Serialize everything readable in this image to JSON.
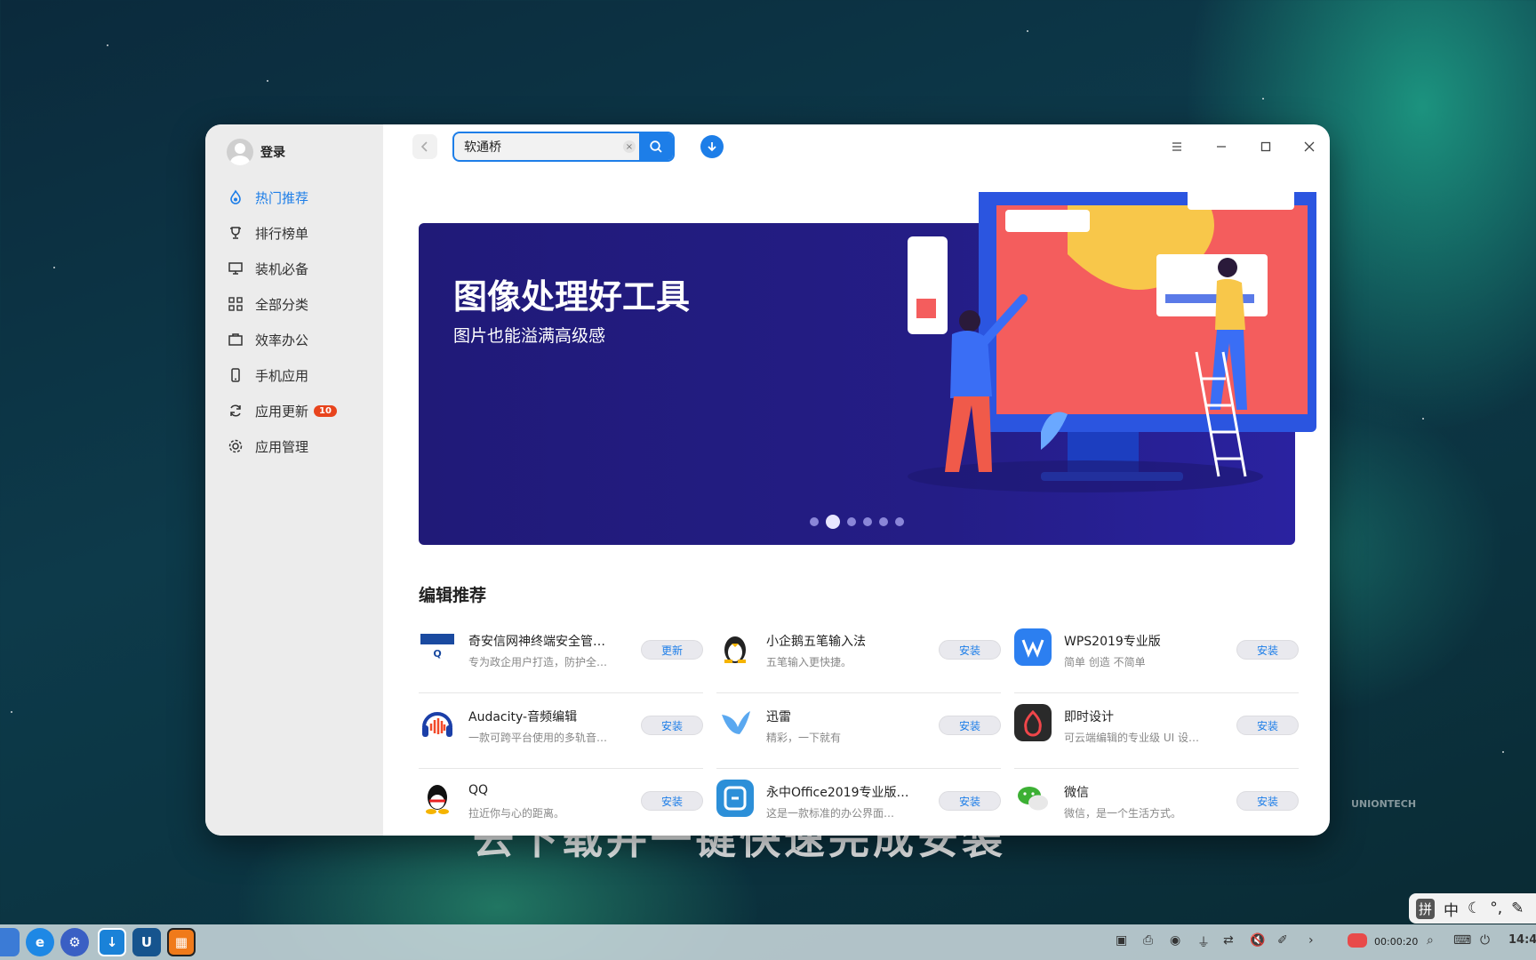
{
  "sidebar": {
    "user_label": "登录",
    "items": [
      {
        "label": "热门推荐",
        "icon": "hot-icon"
      },
      {
        "label": "排行榜单",
        "icon": "trophy-icon"
      },
      {
        "label": "装机必备",
        "icon": "monitor-icon"
      },
      {
        "label": "全部分类",
        "icon": "grid-icon"
      },
      {
        "label": "效率办公",
        "icon": "briefcase-icon"
      },
      {
        "label": "手机应用",
        "icon": "phone-icon"
      },
      {
        "label": "应用更新",
        "icon": "refresh-icon",
        "badge": "10"
      },
      {
        "label": "应用管理",
        "icon": "gear-icon"
      }
    ]
  },
  "search": {
    "value": "软通桥"
  },
  "banner": {
    "title": "图像处理好工具",
    "subtitle": "图片也能溢满高级感",
    "active_dot": 2,
    "dot_count": 6
  },
  "recommend": {
    "title": "编辑推荐",
    "apps": [
      {
        "name": "奇安信网神终端安全管…",
        "desc": "专为政企用户打造，防护全…",
        "button": "更新",
        "icon_color": "#1a4aa0"
      },
      {
        "name": "小企鹅五笔输入法",
        "desc": "五笔输入更快捷。",
        "button": "安装",
        "icon_color": "#ffffff"
      },
      {
        "name": "WPS2019专业版",
        "desc": "简单 创造 不简单",
        "button": "安装",
        "icon_color": "#2c7ff0"
      },
      {
        "name": "Audacity-音频编辑",
        "desc": "一款可跨平台使用的多轨音…",
        "button": "安装",
        "icon_color": "#1b3fa8"
      },
      {
        "name": "迅雷",
        "desc": "精彩，一下就有",
        "button": "安装",
        "icon_color": "#5aa8f0"
      },
      {
        "name": "即时设计",
        "desc": "可云端编辑的专业级 UI 设…",
        "button": "安装",
        "icon_color": "#2a2a2a"
      },
      {
        "name": "QQ",
        "desc": "拉近你与心的距离。",
        "button": "安装",
        "icon_color": "#ffffff"
      },
      {
        "name": "永中Office2019专业版…",
        "desc": "这是一款标准的办公界面…",
        "button": "安装",
        "icon_color": "#2c8fd8"
      },
      {
        "name": "微信",
        "desc": "微信，是一个生活方式。",
        "button": "安装",
        "icon_color": "#ffffff"
      }
    ]
  },
  "overlay": {
    "caption": "去下载并一键快速完成安装",
    "watermark": "UNIONTECH"
  },
  "ime": {
    "pinyin": "拼",
    "zh": "中"
  },
  "taskbar": {
    "record_time": "00:00:20",
    "clock": "14:4"
  }
}
